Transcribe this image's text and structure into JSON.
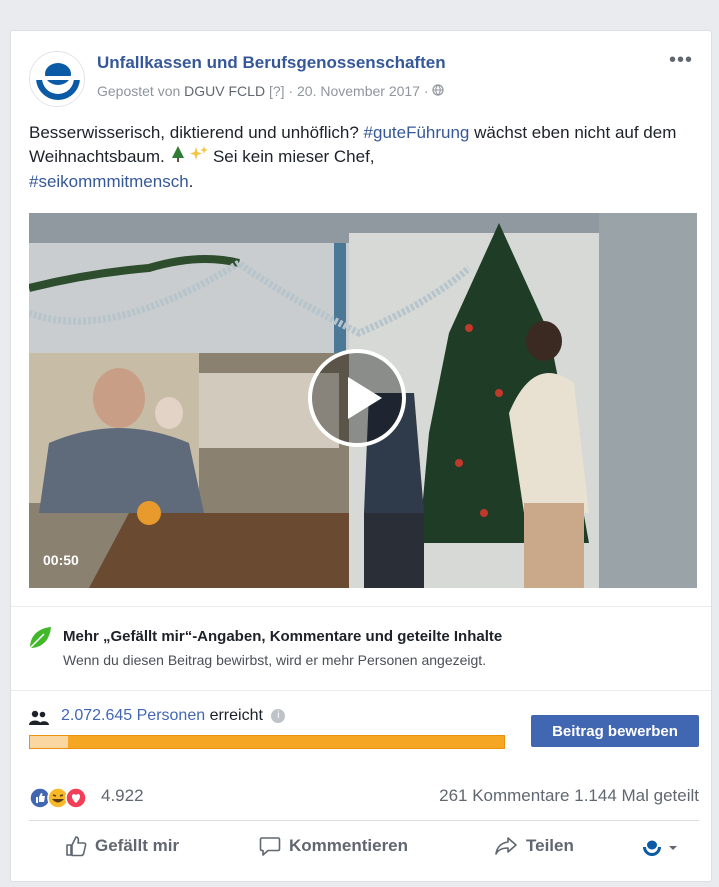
{
  "post": {
    "page_name": "Unfallkassen und Berufsgenossenschaften",
    "posted_by_prefix": "Gepostet von",
    "author": "DGUV FCLD",
    "author_marker": "[?]",
    "date": "20. November 2017",
    "more_icon": "more-dots-icon",
    "text_line1_a": "Besserwisserisch, diktierend und unhöflich?",
    "hashtag1": "#guteFührung",
    "text_line1_b": "wächst eben nicht auf dem Weihnachtsbaum.",
    "text_line2": "Sei kein mieser Chef,",
    "hashtag2": "#seikommmitmensch",
    "text_end": "."
  },
  "video": {
    "duration": "00:50",
    "play_icon": "play-icon"
  },
  "promo": {
    "title": "Mehr „Gefällt mir“-Angaben, Kommentare und geteilte Inhalte",
    "subtitle": "Wenn du diesen Beitrag bewirbst, wird er mehr Personen angezeigt."
  },
  "reach": {
    "count": "2.072.645 Personen",
    "suffix": "erreicht",
    "progress_fraction": 0.08,
    "boost_label": "Beitrag bewerben"
  },
  "stats": {
    "reactions_count": "4.922",
    "comments": "261 Kommentare",
    "shares": "1.144 Mal geteilt"
  },
  "actions": {
    "like": "Gefällt mir",
    "comment": "Kommentieren",
    "share": "Teilen"
  },
  "colors": {
    "link": "#365899",
    "accent": "#4267b2",
    "progress": "#f5a623"
  }
}
